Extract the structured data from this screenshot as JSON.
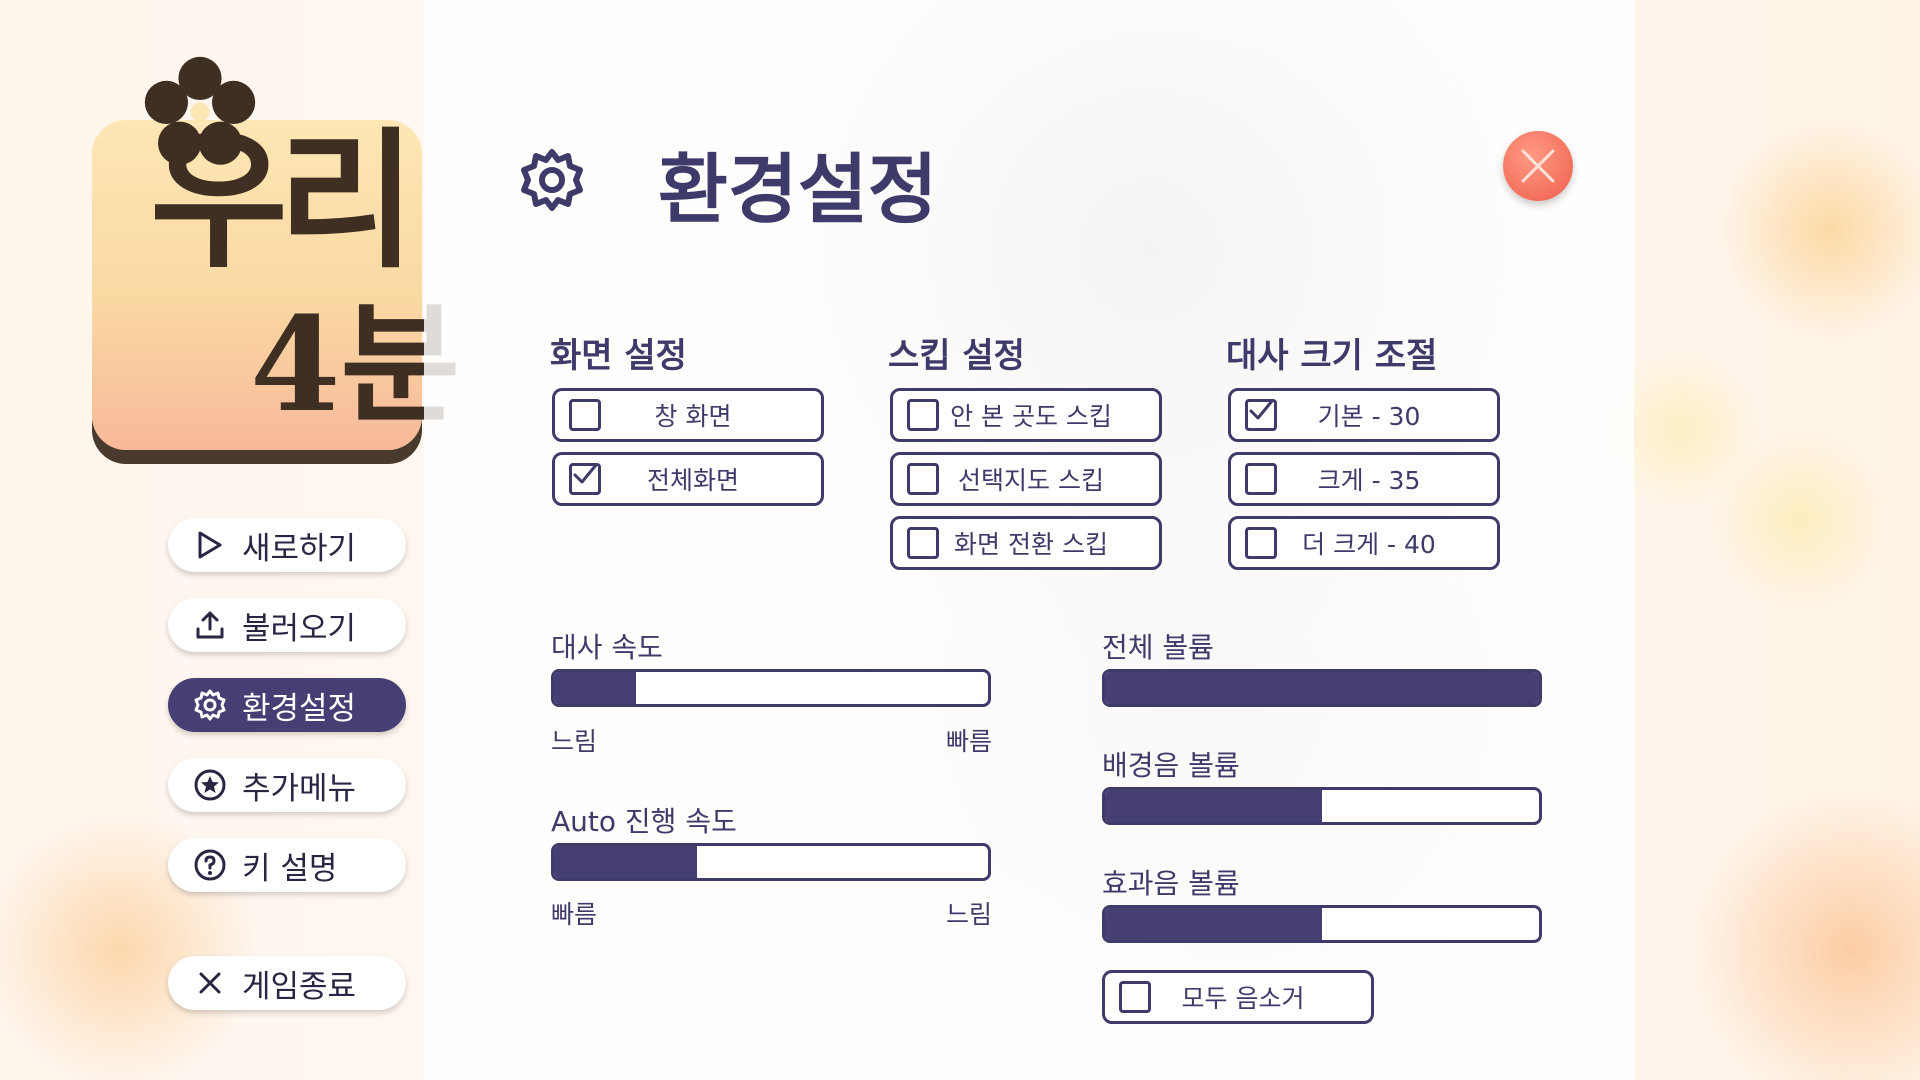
{
  "logo": {
    "line1": "우리",
    "line2": "4분"
  },
  "menu": {
    "items": [
      {
        "label": "새로하기",
        "icon": "play-icon"
      },
      {
        "label": "불러오기",
        "icon": "upload-icon"
      },
      {
        "label": "환경설정",
        "icon": "gear-icon",
        "active": true
      },
      {
        "label": "추가메뉴",
        "icon": "star-icon"
      },
      {
        "label": "키 설명",
        "icon": "question-icon"
      }
    ],
    "exit": {
      "label": "게임종료",
      "icon": "x-icon"
    }
  },
  "settings": {
    "title": "환경설정",
    "screen": {
      "title": "화면 설정",
      "options": [
        {
          "label": "창 화면",
          "checked": false
        },
        {
          "label": "전체화면",
          "checked": true
        }
      ]
    },
    "skip": {
      "title": "스킵 설정",
      "options": [
        {
          "label": "안 본 곳도 스킵",
          "checked": false
        },
        {
          "label": "선택지도 스킵",
          "checked": false
        },
        {
          "label": "화면 전환 스킵",
          "checked": false
        }
      ]
    },
    "text_size": {
      "title": "대사 크기 조절",
      "options": [
        {
          "label": "기본 - 30",
          "checked": true
        },
        {
          "label": "크게 - 35",
          "checked": false
        },
        {
          "label": "더 크게 - 40",
          "checked": false
        }
      ]
    },
    "text_speed": {
      "label": "대사 속도",
      "min_label": "느림",
      "max_label": "빠름",
      "value": 0.19
    },
    "auto_speed": {
      "label": "Auto 진행 속도",
      "min_label": "빠름",
      "max_label": "느림",
      "value": 0.33
    },
    "master_volume": {
      "label": "전체 볼륨",
      "value": 1.0
    },
    "bgm_volume": {
      "label": "배경음 볼륨",
      "value": 0.5
    },
    "sfx_volume": {
      "label": "효과음 볼륨",
      "value": 0.5
    },
    "mute_all": {
      "label": "모두 음소거",
      "checked": false
    }
  },
  "colors": {
    "accent": "#453f74",
    "close": "#f3705c"
  }
}
